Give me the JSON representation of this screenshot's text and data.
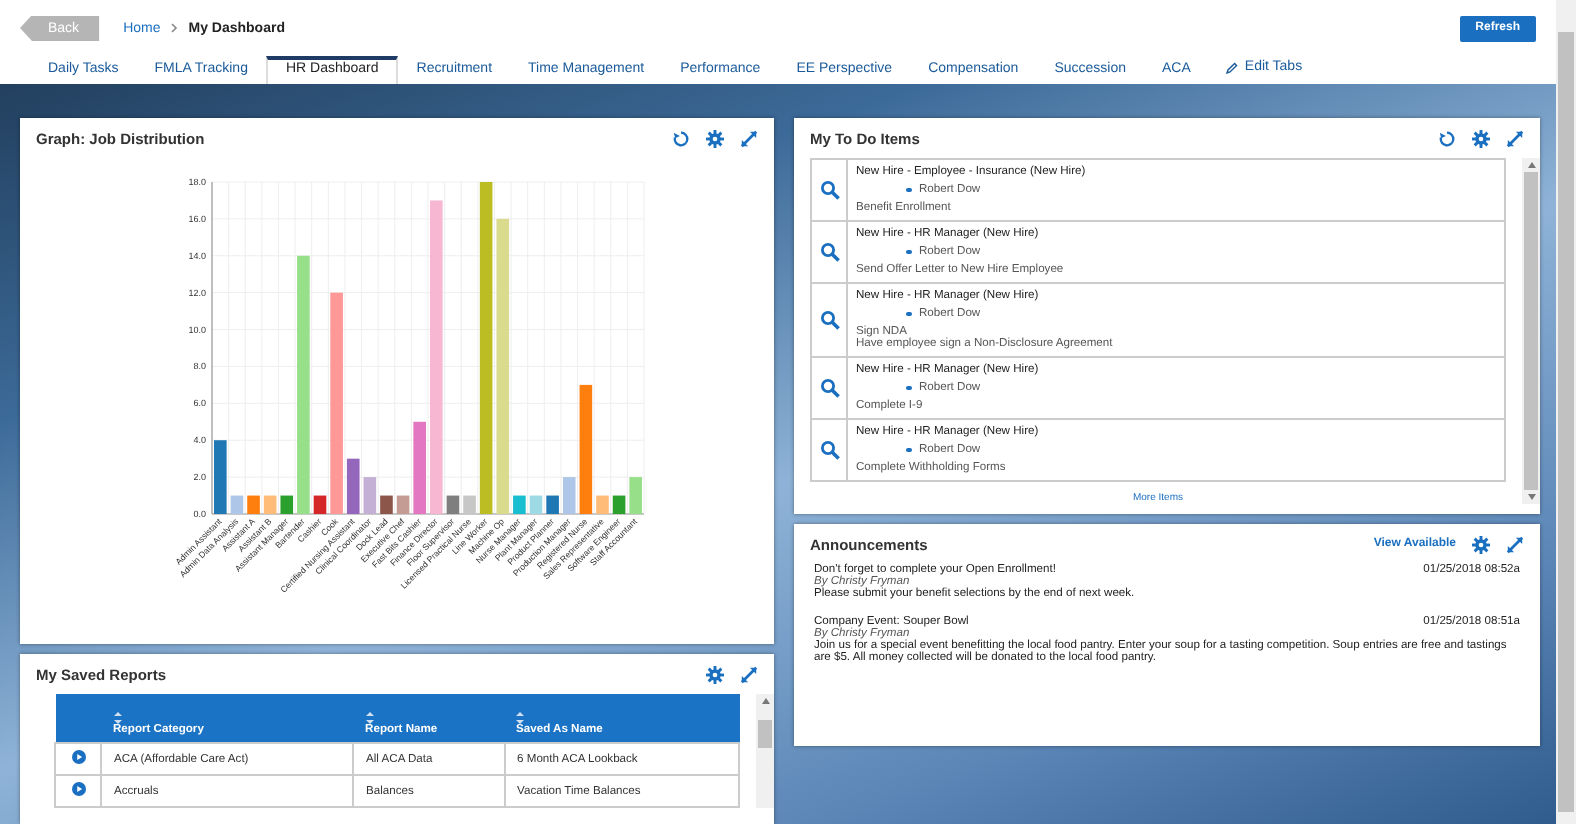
{
  "header": {
    "back": "Back",
    "breadcrumb": [
      "Home",
      "My Dashboard"
    ],
    "refresh": "Refresh"
  },
  "tabs": [
    {
      "label": "Daily Tasks",
      "selected": false
    },
    {
      "label": "FMLA Tracking",
      "selected": false
    },
    {
      "label": "HR Dashboard",
      "selected": true
    },
    {
      "label": "Recruitment",
      "selected": false
    },
    {
      "label": "Time Management",
      "selected": false
    },
    {
      "label": "Performance",
      "selected": false
    },
    {
      "label": "EE Perspective",
      "selected": false
    },
    {
      "label": "Compensation",
      "selected": false
    },
    {
      "label": "Succession",
      "selected": false
    },
    {
      "label": "ACA",
      "selected": false
    }
  ],
  "edit_tabs": "Edit Tabs",
  "graph_panel": {
    "title": "Graph: Job Distribution",
    "chart_data": {
      "type": "bar",
      "categories": [
        "Admin Assistant",
        "Admin Data Analysis",
        "Assistant A",
        "Assistant B",
        "Assistant Manager",
        "Bartender",
        "Cashier",
        "Cook",
        "Certified Nursing Assistant",
        "Clinical Coordinator",
        "Dock Lead",
        "Executive Chef",
        "Fast Bits Cashier",
        "Finance Director",
        "Floor Supervisor",
        "Licensed Practical Nurse",
        "Line Worker",
        "Machine Op",
        "Nurse Manager",
        "Plant Manager",
        "Product Planner",
        "Production Manager",
        "Registered Nurse",
        "Sales Representative",
        "Software Engineer",
        "Staff Accountant"
      ],
      "values": [
        4,
        1,
        1,
        1,
        1,
        14,
        1,
        12,
        3,
        2,
        1,
        1,
        5,
        17,
        1,
        1,
        18,
        16,
        1,
        1,
        1,
        2,
        7,
        1,
        1,
        2
      ],
      "colors": [
        "#1f77b4",
        "#aec7e8",
        "#ff7f0e",
        "#ffbb78",
        "#2ca02c",
        "#98df8a",
        "#d62728",
        "#ff9896",
        "#9467bd",
        "#c5b0d5",
        "#8c564b",
        "#c49c94",
        "#e377c2",
        "#f7b6d2",
        "#7f7f7f",
        "#c7c7c7",
        "#bcbd22",
        "#dbdb8d",
        "#17becf",
        "#9edae5",
        "#1f77b4",
        "#aec7e8",
        "#ff7f0e",
        "#ffbb78",
        "#2ca02c",
        "#98df8a"
      ],
      "ylim": [
        0,
        18
      ],
      "grid": true,
      "yticks": [
        {
          "value": 0,
          "label": "0.0"
        },
        {
          "value": 2,
          "label": "2.0"
        },
        {
          "value": 4,
          "label": "4.0"
        },
        {
          "value": 6,
          "label": "6.0"
        },
        {
          "value": 8,
          "label": "8.0"
        },
        {
          "value": 10,
          "label": "10.0"
        },
        {
          "value": 12,
          "label": "12.0"
        },
        {
          "value": 14,
          "label": "14.0"
        },
        {
          "value": 16,
          "label": "16.0"
        },
        {
          "value": 18,
          "label": "18.0"
        }
      ]
    }
  },
  "todo_panel": {
    "title": "My To Do Items",
    "more": "More Items",
    "items": [
      {
        "title": "New Hire - Employee - Insurance (New Hire)",
        "person": "Robert Dow",
        "lines": [
          "Benefit Enrollment"
        ]
      },
      {
        "title": "New Hire - HR Manager (New Hire)",
        "person": "Robert Dow",
        "lines": [
          "Send Offer Letter to New Hire Employee"
        ]
      },
      {
        "title": "New Hire - HR Manager (New Hire)",
        "person": "Robert Dow",
        "lines": [
          "Sign NDA",
          "Have employee sign a Non-Disclosure Agreement"
        ]
      },
      {
        "title": "New Hire - HR Manager (New Hire)",
        "person": "Robert Dow",
        "lines": [
          "Complete I-9"
        ]
      },
      {
        "title": "New Hire - HR Manager (New Hire)",
        "person": "Robert Dow",
        "lines": [
          "Complete Withholding Forms"
        ]
      }
    ]
  },
  "announcements_panel": {
    "title": "Announcements",
    "view_available": "View Available",
    "items": [
      {
        "title": "Don't forget to complete your Open Enrollment!",
        "date": "01/25/2018 08:52a",
        "author": "By Christy Fryman",
        "body": "Please submit your benefit selections by the end of next week."
      },
      {
        "title": "Company Event: Souper Bowl",
        "date": "01/25/2018 08:51a",
        "author": "By Christy Fryman",
        "body": "Join us for a special event benefitting the local food pantry. Enter your soup for a tasting competition. Soup entries are free and tastings are $5. All money collected will be donated to the local food pantry."
      }
    ]
  },
  "reports_panel": {
    "title": "My Saved Reports",
    "columns": [
      "Report Category",
      "Report Name",
      "Saved As Name"
    ],
    "rows": [
      [
        "ACA (Affordable Care Act)",
        "All ACA Data",
        "6 Month ACA Lookback"
      ],
      [
        "Accruals",
        "Balances",
        "Vacation Time Balances"
      ]
    ]
  }
}
